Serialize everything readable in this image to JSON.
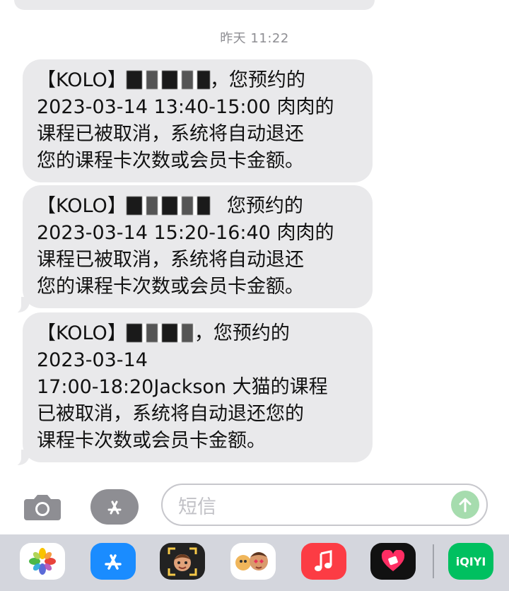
{
  "conversation": {
    "timestamp": "昨天 11:22",
    "messages": [
      {
        "lines": [
          "【KOLO】",
          "，您预约的",
          "2023-03-14 13:40-15:00 肉肉的",
          "课程已被取消，系统将自动退还",
          "您的课程卡次数或会员卡金额。"
        ]
      },
      {
        "lines": [
          "【KOLO】",
          "您预约的",
          "2023-03-14 15:20-16:40 肉肉的",
          "课程已被取消，系统将自动退还",
          "您的课程卡次数或会员卡金额。"
        ]
      },
      {
        "lines": [
          "【KOLO】",
          "，您预约的",
          "2023-03-14",
          "17:00-18:20Jackson 大猫的课程",
          "已被取消，系统将自动退还您的",
          "课程卡次数或会员卡金额。"
        ]
      }
    ]
  },
  "input": {
    "placeholder": "短信"
  },
  "icons": {
    "camera": "camera-icon",
    "apps": "app-store-icon",
    "send": "arrow-up-icon"
  },
  "dock": {
    "apps": [
      {
        "name": "photos-app",
        "color": "#ffffff"
      },
      {
        "name": "app-store-app",
        "color": "#1a8cff"
      },
      {
        "name": "memoji-app",
        "color": "#222222"
      },
      {
        "name": "animoji-app",
        "color": "#ffffff"
      },
      {
        "name": "music-app",
        "color": "#fc3c44"
      },
      {
        "name": "fitness-app",
        "color": "#111111"
      },
      {
        "name": "iqiyi-app",
        "color": "#00c060",
        "label": "iQIYI"
      }
    ]
  },
  "colors": {
    "bubble": "#e9e9eb",
    "timestamp": "#8e8e93",
    "send_disabled": "#a6dcae"
  }
}
